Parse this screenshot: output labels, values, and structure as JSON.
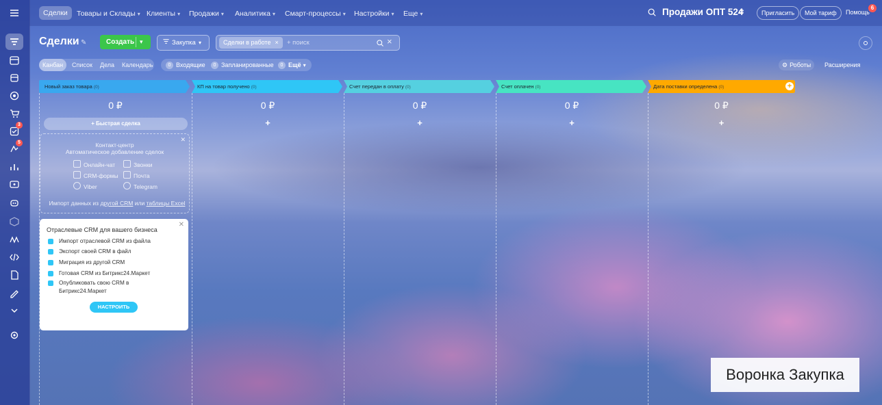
{
  "nav": {
    "items": [
      {
        "label": "Сделки",
        "active": true
      },
      {
        "label": "Товары и Склады",
        "caret": true
      },
      {
        "label": "Клиенты",
        "caret": true
      },
      {
        "label": "Продажи",
        "caret": true
      },
      {
        "label": "Аналитика",
        "caret": true
      },
      {
        "label": "Смарт-процессы",
        "caret": true
      },
      {
        "label": "Настройки",
        "caret": true
      },
      {
        "label": "Еще",
        "caret": true
      }
    ],
    "portal_name": "Продажи ОПТ 524",
    "invite_label": "Пригласить",
    "tariff_label": "Мой тариф",
    "help_label": "Помощь",
    "help_badge": "6"
  },
  "sidebar_badges": {
    "tasks": "3",
    "feed": "5"
  },
  "toolbar": {
    "page_title": "Сделки",
    "create_label": "Создать",
    "funnel_label": "Закупка",
    "filter_chip": "Сделки в работе",
    "search_placeholder": "+ поиск"
  },
  "views": [
    {
      "label": "Канбан",
      "active": true
    },
    {
      "label": "Список"
    },
    {
      "label": "Дела"
    },
    {
      "label": "Календарь"
    }
  ],
  "counters": [
    {
      "num": "0",
      "label": "Входящие"
    },
    {
      "num": "0",
      "label": "Запланированные"
    },
    {
      "num": "0",
      "label": "Ещё"
    }
  ],
  "robots_label": "Роботы",
  "extensions_label": "Расширения",
  "columns": [
    {
      "title": "Новый заказ товара",
      "count": "(0)",
      "sum": "0 ₽",
      "color": "#39a8ef"
    },
    {
      "title": "КП на товар получено",
      "count": "(0)",
      "sum": "0 ₽",
      "color": "#2fc6f6"
    },
    {
      "title": "Счет передан в оплату",
      "count": "(0)",
      "sum": "0 ₽",
      "color": "#55d0e0"
    },
    {
      "title": "Счет оплачен",
      "count": "(0)",
      "sum": "0 ₽",
      "color": "#47e4c2"
    },
    {
      "title": "Дата поставки определена",
      "count": "(0)",
      "sum": "0 ₽",
      "color": "#ffa900"
    }
  ],
  "quick_deal_label": "+ Быстрая сделка",
  "plus_label": "+",
  "contact_center": {
    "title": "Контакт-центр",
    "subtitle": "Автоматическое добавление сделок",
    "sources": [
      "Онлайн-чат",
      "Звонки",
      "CRM-формы",
      "Почта",
      "Viber",
      "Telegram"
    ],
    "import_prefix": "Импорт данных из",
    "import_link1": "другой CRM",
    "import_mid": "или",
    "import_link2": "таблицы Excel"
  },
  "promo": {
    "title": "Отраслевые CRM для вашего бизнеса",
    "items": [
      "Импорт отраслевой CRM из файла",
      "Экспорт своей CRM в файл",
      "Миграция из другой CRM",
      "Готовая CRM из Битрикс24.Маркет",
      "Опубликовать свою CRM в",
      "Битрикс24.Маркет"
    ],
    "button_label": "НАСТРОИТЬ"
  },
  "funnel_caption": "Воронка Закупка"
}
